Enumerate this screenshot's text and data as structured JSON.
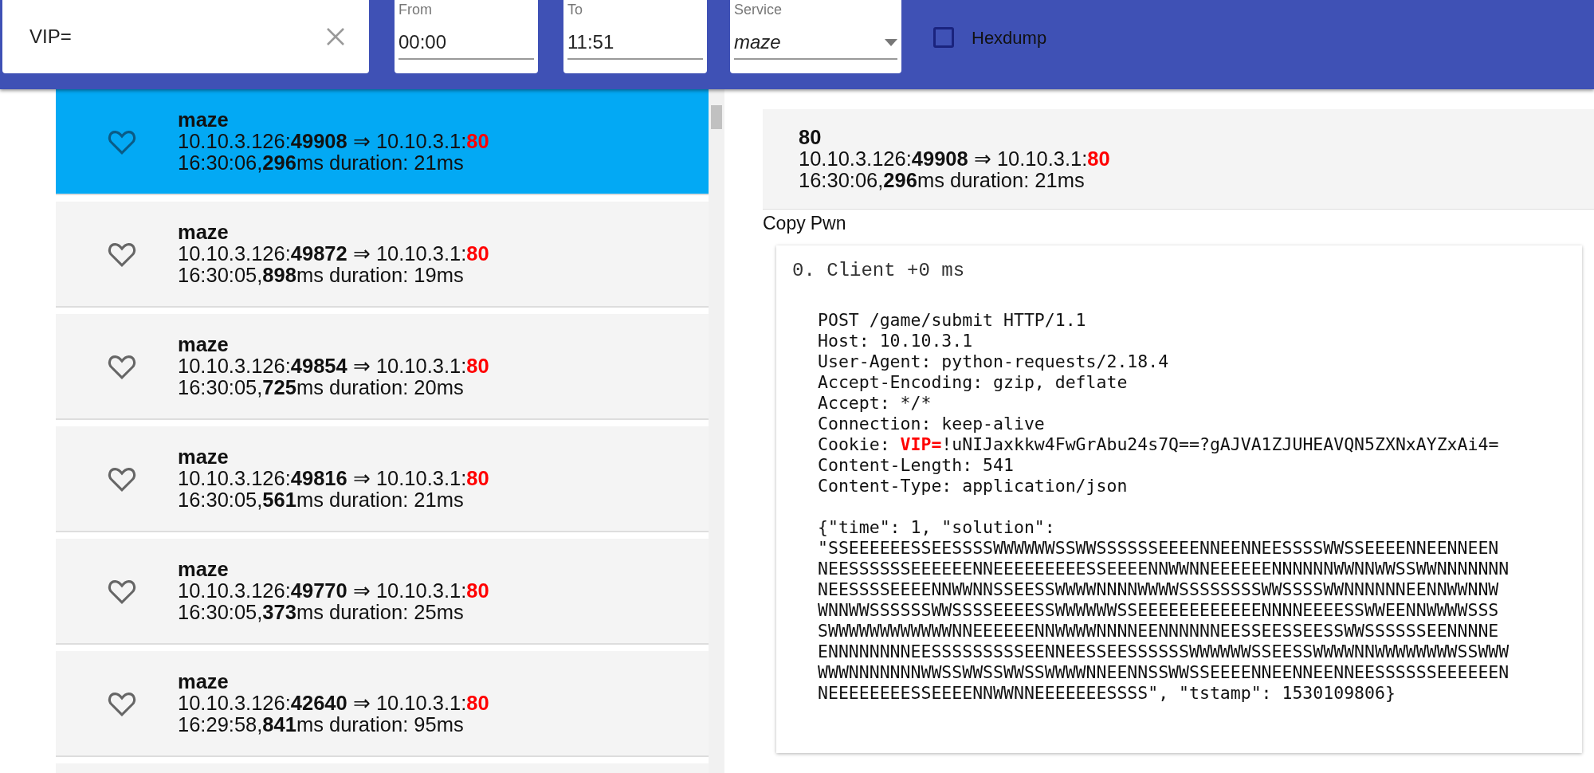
{
  "toolbar": {
    "search": {
      "value": "VIP="
    },
    "from": {
      "label": "From",
      "value": "00:00"
    },
    "to": {
      "label": "To",
      "value": "11:51"
    },
    "service": {
      "label": "Service",
      "value": "maze"
    },
    "hexdump": {
      "label": "Hexdump",
      "checked": false
    }
  },
  "flows": [
    {
      "service": "maze",
      "address": "10.10.3.126:**49908** ⇒ 10.10.3.1:",
      "port": "80",
      "timing": "16:30:06,**296**ms duration: 21ms",
      "selected": true
    },
    {
      "service": "maze",
      "address": "10.10.3.126:**49872** ⇒ 10.10.3.1:",
      "port": "80",
      "timing": "16:30:05,**898**ms duration: 19ms",
      "selected": false
    },
    {
      "service": "maze",
      "address": "10.10.3.126:**49854** ⇒ 10.10.3.1:",
      "port": "80",
      "timing": "16:30:05,**725**ms duration: 20ms",
      "selected": false
    },
    {
      "service": "maze",
      "address": "10.10.3.126:**49816** ⇒ 10.10.3.1:",
      "port": "80",
      "timing": "16:30:05,**561**ms duration: 21ms",
      "selected": false
    },
    {
      "service": "maze",
      "address": "10.10.3.126:**49770** ⇒ 10.10.3.1:",
      "port": "80",
      "timing": "16:30:05,**373**ms duration: 25ms",
      "selected": false
    },
    {
      "service": "maze",
      "address": "10.10.3.126:**42640** ⇒ 10.10.3.1:",
      "port": "80",
      "timing": "16:29:58,**841**ms duration: 95ms",
      "selected": false
    }
  ],
  "detail": {
    "title": "80",
    "address": "10.10.3.126:**49908** ⇒ 10.10.3.1:",
    "port": "80",
    "timing": "16:30:06,**296**ms duration: 21ms",
    "actions": [
      "Copy",
      "Pwn"
    ],
    "message": {
      "title": "0. Client +0 ms",
      "headers": [
        {
          "kind": "plain",
          "text": "POST /game/submit HTTP/1.1"
        },
        {
          "kind": "plain",
          "text": "Host: 10.10.3.1"
        },
        {
          "kind": "plain",
          "text": "User-Agent: python-requests/2.18.4"
        },
        {
          "kind": "plain",
          "text": "Accept-Encoding: gzip, deflate"
        },
        {
          "kind": "plain",
          "text": "Accept: */*"
        },
        {
          "kind": "plain",
          "text": "Connection: keep-alive"
        },
        {
          "kind": "match",
          "text": "Cookie: ",
          "match": "VIP=",
          "rest": "!uNIJaxkkw4FwGrAbu24s7Q==?gAJVA1ZJUHEAVQN5ZXNxAYZxAi4="
        },
        {
          "kind": "plain",
          "text": "Content-Length: 541"
        },
        {
          "kind": "plain",
          "text": "Content-Type: application/json"
        }
      ],
      "body": [
        "{\"time\": 1, \"solution\":",
        "\"SSEEEEEESSEESSSSWWWWWWSSWWSSSSSSEEEENNEENNEESSSSWWSSEEEENNEENNEEN",
        "NEESSSSSSEEEEEENNEEEEEEEEESSEEEENNWWNNEEEEEENNNNNNWWNNWWSSWWNNNNNNN",
        "NEESSSSEEEENNWWNNSSEESSWWWWNNNNWWWWSSSSSSSSWWSSSSWWNNNNNNEENNWWNNW",
        "WNNWWSSSSSSWWSSSSEEEESSWWWWWWSSEEEEEEEEEEEENNNNEEEESSWWEENNWWWWSSS",
        "SWWWWWWWWWWWWNNEEEEEENNWWWWNNNNEENNNNNNEESSEESSEESSWWSSSSSSEENNNNE",
        "ENNNNNNNNEESSSSSSSSSEENNEESSEESSSSSSWWWWWWSSEESSWWWWNNWWWWWWWWSSWWW",
        "WWWNNNNNNNWWSSWWSSWWSSWWWWNNEENNSSWWSSEEEENNEENNEENNEESSSSSSEEEEEEN",
        "NEEEEEEEESSEEEENNWWNNEEEEEEESSSS\", \"tstamp\": 1530109806}"
      ]
    }
  }
}
